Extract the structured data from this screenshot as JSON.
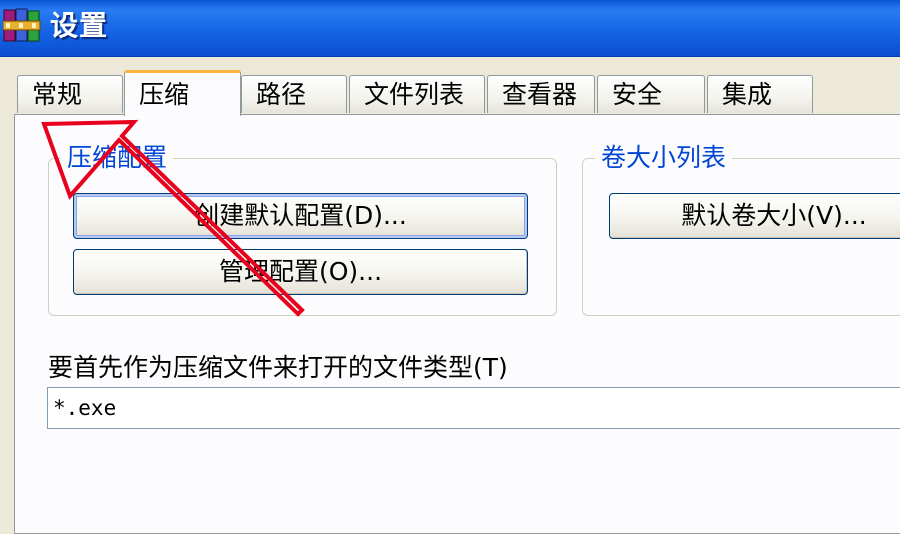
{
  "window": {
    "title": "设置",
    "icon": "winrar-books-icon"
  },
  "tabs": [
    {
      "label": "常规",
      "active": false
    },
    {
      "label": "压缩",
      "active": true
    },
    {
      "label": "路径",
      "active": false
    },
    {
      "label": "文件列表",
      "active": false
    },
    {
      "label": "查看器",
      "active": false
    },
    {
      "label": "安全",
      "active": false
    },
    {
      "label": "集成",
      "active": false
    }
  ],
  "compression_profiles": {
    "title": "压缩配置",
    "create_default_button": "创建默认配置(D)...",
    "manage_button": "管理配置(O)..."
  },
  "volume_sizes": {
    "title": "卷大小列表",
    "default_volume_button": "默认卷大小(V)..."
  },
  "open_as_archive": {
    "label": "要首先作为压缩文件来打开的文件类型(T)",
    "value": "*.exe"
  },
  "annotation": {
    "arrow_color": "#e8001c",
    "icon": "red-arrow-annotation"
  }
}
